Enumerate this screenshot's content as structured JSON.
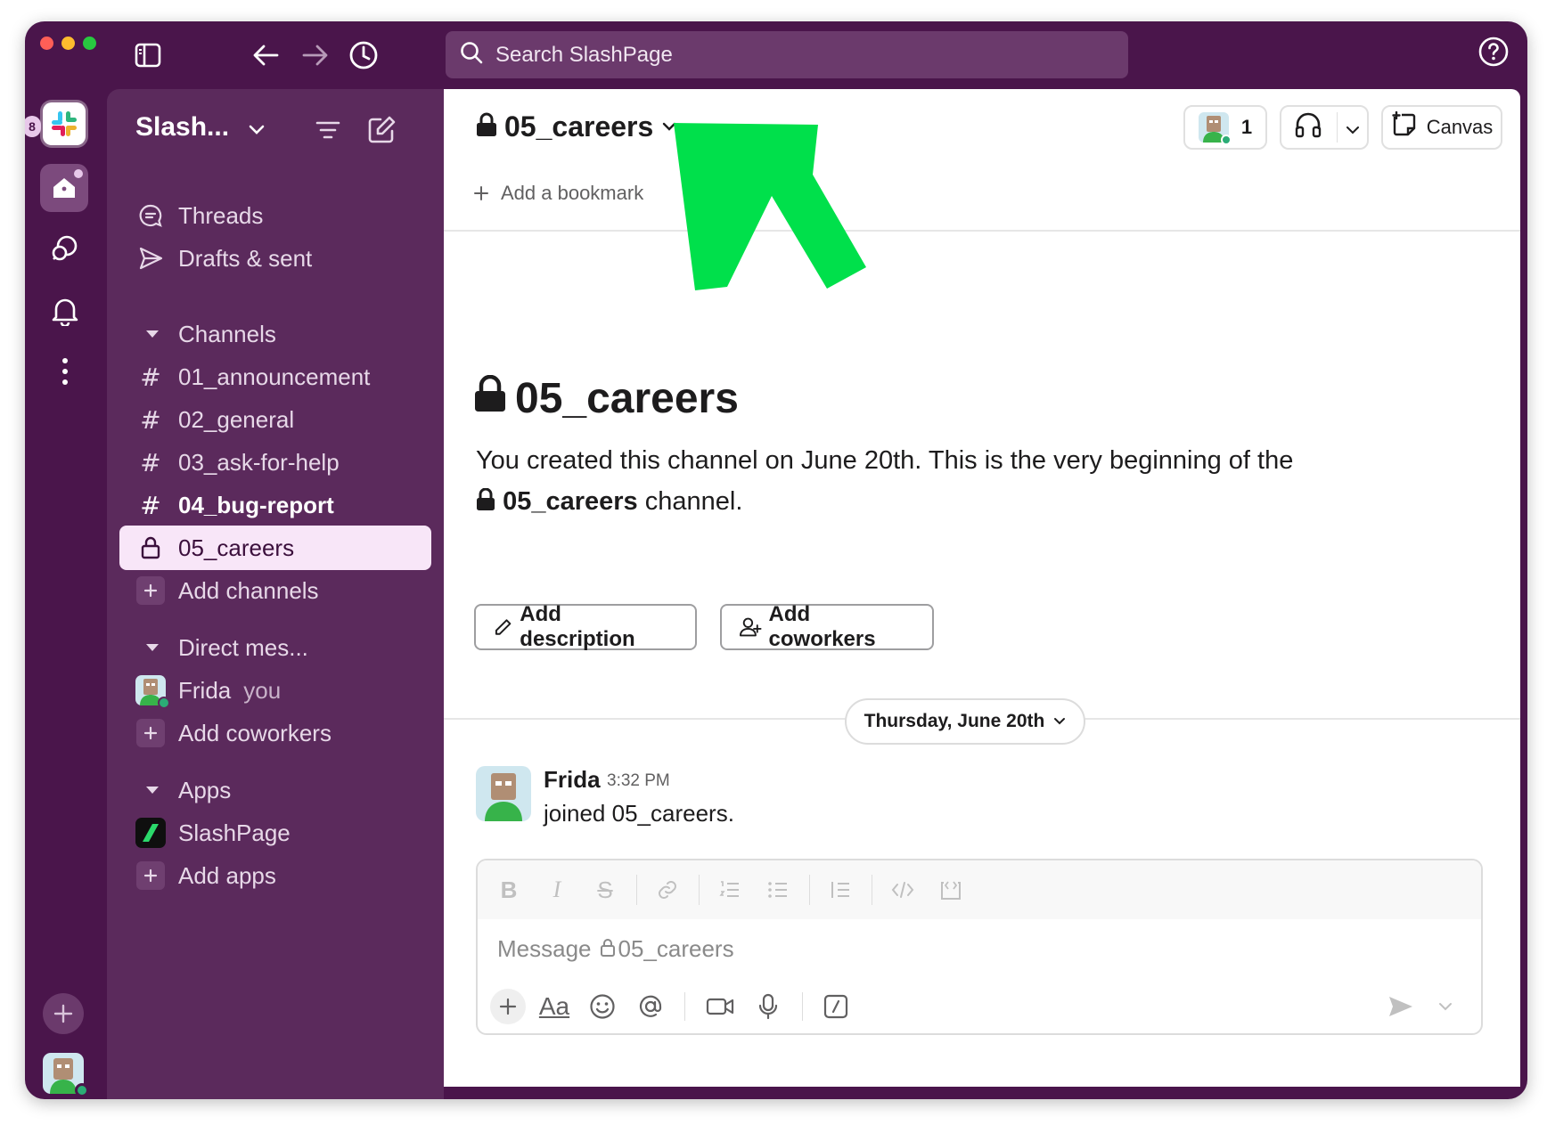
{
  "topbar": {
    "search_placeholder": "Search SlashPage"
  },
  "rail": {
    "workspace_badge": "8"
  },
  "sidebar": {
    "workspace_name": "Slash...",
    "threads": "Threads",
    "drafts": "Drafts & sent",
    "channels_header": "Channels",
    "channels": [
      {
        "name": "01_announcement",
        "private": false,
        "bold": false
      },
      {
        "name": "02_general",
        "private": false,
        "bold": false
      },
      {
        "name": "03_ask-for-help",
        "private": false,
        "bold": false
      },
      {
        "name": "04_bug-report",
        "private": false,
        "bold": true
      },
      {
        "name": "05_careers",
        "private": true,
        "bold": false
      }
    ],
    "add_channels": "Add channels",
    "dm_header": "Direct mes...",
    "dm_user": "Frida",
    "dm_you": "you",
    "add_coworkers": "Add coworkers",
    "apps_header": "Apps",
    "app_name": "SlashPage",
    "add_apps": "Add apps",
    "active_channel": "05_careers"
  },
  "header": {
    "channel_name": "05_careers",
    "member_count": "1",
    "canvas_label": "Canvas",
    "add_bookmark": "Add a bookmark"
  },
  "intro": {
    "title": "05_careers",
    "desc_line1": "You created this channel on June 20th. This is the very beginning of the",
    "desc_channel": "05_careers",
    "desc_suffix": " channel.",
    "add_description": "Add description",
    "add_coworkers": "Add coworkers"
  },
  "feed": {
    "day_label": "Thursday, June 20th",
    "messages": [
      {
        "author": "Frida",
        "time": "3:32 PM",
        "text": "joined 05_careers."
      }
    ]
  },
  "composer": {
    "placeholder_prefix": "Message",
    "placeholder_channel": "05_careers",
    "format_label": "Aa"
  },
  "colors": {
    "aubergine": "#4a154b",
    "sidebar": "#5b2a5c",
    "active_item": "#f8e6f8",
    "annotation_arrow": "#00e04b",
    "presence": "#2bac76"
  }
}
